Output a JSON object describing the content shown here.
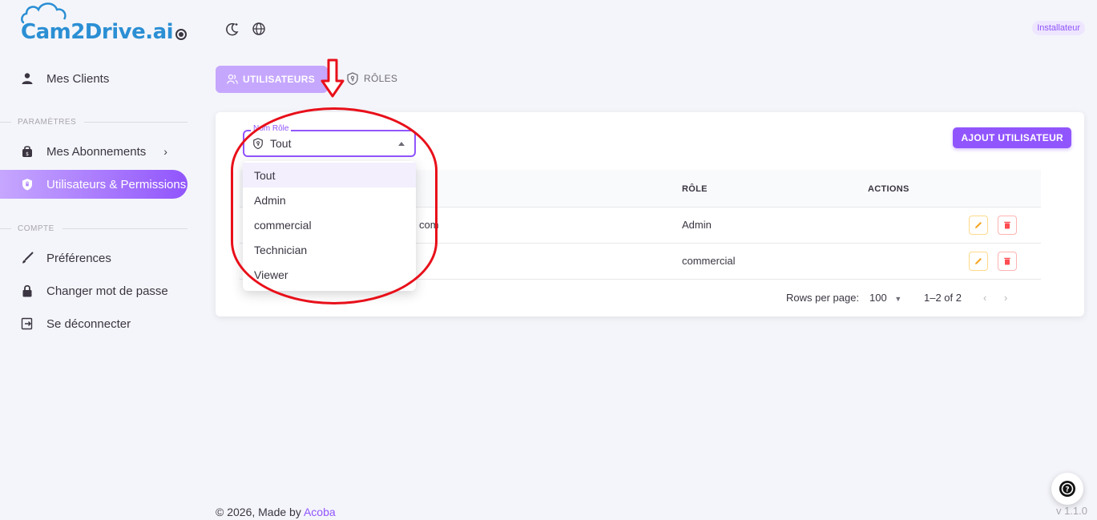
{
  "brand": {
    "name": "Cam2Drive.ai"
  },
  "topbar": {
    "user_role": "Installateur"
  },
  "sidebar": {
    "clients": "Mes Clients",
    "section_params": "PARAMÈTRES",
    "subscriptions": "Mes Abonnements",
    "users_permissions": "Utilisateurs & Permissions",
    "section_account": "COMPTE",
    "preferences": "Préférences",
    "change_password": "Changer mot de passe",
    "logout": "Se déconnecter"
  },
  "tabs": {
    "users": "UTILISATEURS",
    "roles": "RÔLES"
  },
  "filter": {
    "label": "Nom Rôle",
    "value": "Tout",
    "options": [
      "Tout",
      "Admin",
      "commercial",
      "Technician",
      "Viewer"
    ]
  },
  "add_user_label": "AJOUT UTILISATEUR",
  "table": {
    "headers": {
      "role": "RÔLE",
      "actions": "ACTIONS"
    },
    "rows": [
      {
        "email_fragment": "com",
        "role": "Admin"
      },
      {
        "email_fragment": "",
        "role": "commercial"
      }
    ]
  },
  "pagination": {
    "rows_per_page_label": "Rows per page:",
    "rows_per_page": "100",
    "range": "1–2 of 2"
  },
  "footer": {
    "copyright": "© 2026, Made by ",
    "link": "Acoba",
    "version": "v 1.1.0"
  },
  "colors": {
    "primary": "#9155fd",
    "annotation": "#e8101a",
    "logo": "#2b8fd4"
  },
  "icons": [
    "user-icon",
    "bag-icon",
    "shield-icon",
    "brush-icon",
    "lock-icon",
    "logout-icon",
    "moon-icon",
    "globe-icon",
    "users-icon",
    "shield-key-icon",
    "pencil-icon",
    "trash-icon",
    "help-icon"
  ]
}
